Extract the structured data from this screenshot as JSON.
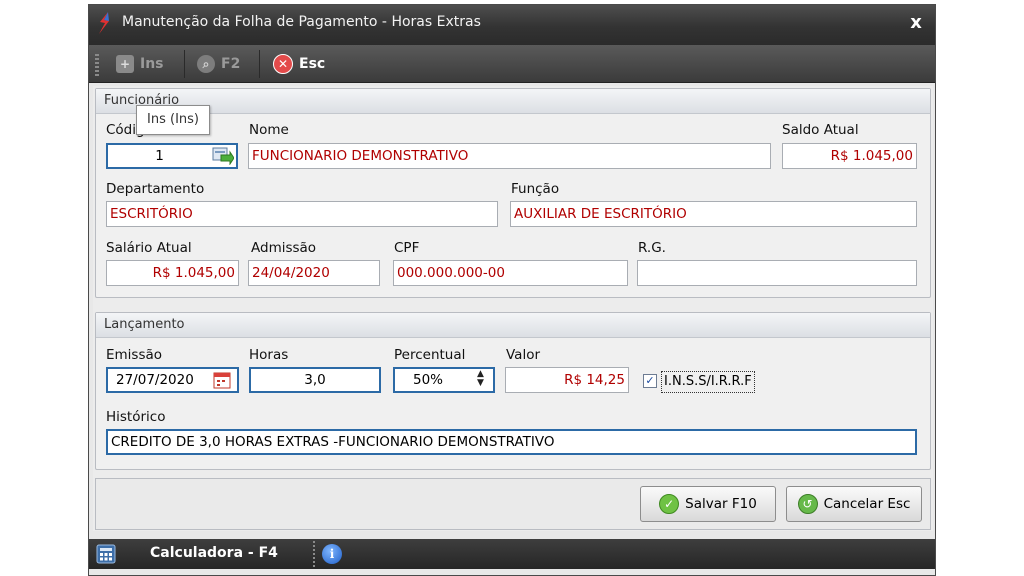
{
  "window": {
    "title": "Manutenção da Folha de Pagamento - Horas Extras",
    "close_glyph": "x"
  },
  "toolbar": {
    "ins_label": "Ins",
    "f2_label": "F2",
    "esc_label": "Esc"
  },
  "tooltip": "Ins (Ins)",
  "funcionario": {
    "group_title": "Funcionário",
    "codigo_label": "Código",
    "codigo_value": "1",
    "nome_label": "Nome",
    "nome_value": "FUNCIONARIO DEMONSTRATIVO",
    "saldo_label": "Saldo Atual",
    "saldo_value": "R$ 1.045,00",
    "departamento_label": "Departamento",
    "departamento_value": "ESCRITÓRIO",
    "funcao_label": "Função",
    "funcao_value": "AUXILIAR DE ESCRITÓRIO",
    "salario_label": "Salário Atual",
    "salario_value": "R$ 1.045,00",
    "admissao_label": "Admissão",
    "admissao_value": "24/04/2020",
    "cpf_label": "CPF",
    "cpf_value": "000.000.000-00",
    "rg_label": "R.G.",
    "rg_value": ""
  },
  "lancamento": {
    "group_title": "Lançamento",
    "emissao_label": "Emissão",
    "emissao_value": "27/07/2020",
    "horas_label": "Horas",
    "horas_value": "3,0",
    "percentual_label": "Percentual",
    "percentual_value": "50%",
    "valor_label": "Valor",
    "valor_value": "R$ 14,25",
    "inss_label": "I.N.S.S/I.R.R.F",
    "inss_checked": true,
    "historico_label": "Histórico",
    "historico_value": "CREDITO DE 3,0 HORAS EXTRAS -FUNCIONARIO DEMONSTRATIVO"
  },
  "buttons": {
    "salvar_label": "Salvar F10",
    "cancelar_label": "Cancelar Esc"
  },
  "statusbar": {
    "calculadora_label": "Calculadora - F4"
  },
  "colors": {
    "value_red": "#b00000",
    "focus_blue": "#2c6aa6",
    "title_dark": "#333333"
  }
}
